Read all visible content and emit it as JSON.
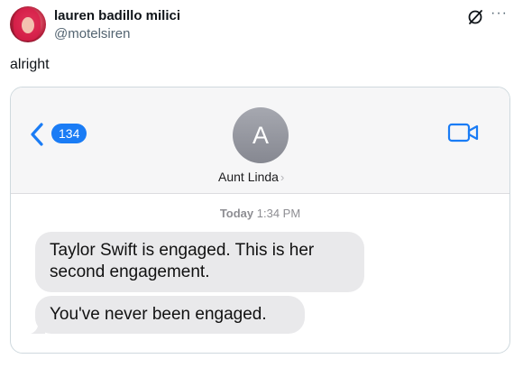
{
  "tweet": {
    "display_name": "lauren badillo milici",
    "handle": "@motelsiren",
    "text": "alright",
    "more_label": "···",
    "grok_icon": "grok-icon"
  },
  "message_screenshot": {
    "back_icon": "chevron-left-icon",
    "unread_count": "134",
    "contact_initial": "A",
    "contact_name": "Aunt Linda",
    "contact_chevron": "›",
    "video_icon": "video-camera-icon",
    "accent_color": "#1a7cf5",
    "timestamp_day": "Today",
    "timestamp_time": "1:34 PM",
    "messages": [
      {
        "text": "Taylor Swift is engaged. This is her second engagement."
      },
      {
        "text": "You've never been engaged."
      }
    ]
  }
}
